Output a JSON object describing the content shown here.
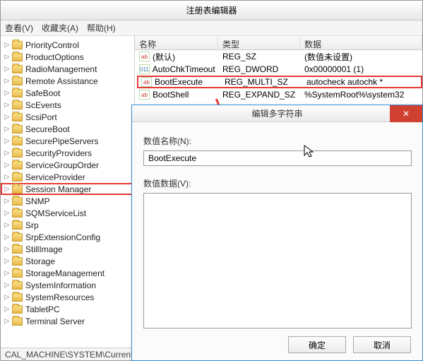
{
  "window": {
    "title": "注册表编辑器"
  },
  "menu": {
    "view": "查看(V)",
    "fav": "收藏夹(A)",
    "help": "帮助(H)"
  },
  "tree": {
    "items": [
      "PriorityControl",
      "ProductOptions",
      "RadioManagement",
      "Remote Assistance",
      "SafeBoot",
      "ScEvents",
      "ScsiPort",
      "SecureBoot",
      "SecurePipeServers",
      "SecurityProviders",
      "ServiceGroupOrder",
      "ServiceProvider",
      "Session Manager",
      "SNMP",
      "SQMServiceList",
      "Srp",
      "SrpExtensionConfig",
      "StillImage",
      "Storage",
      "StorageManagement",
      "SystemInformation",
      "SystemResources",
      "TabletPC",
      "Terminal Server"
    ],
    "highlighted_index": 12
  },
  "list": {
    "headers": {
      "name": "名称",
      "type": "类型",
      "data": "数据"
    },
    "rows": [
      {
        "icon": "sz",
        "name": "(默认)",
        "type": "REG_SZ",
        "data": "(数值未设置)"
      },
      {
        "icon": "bin",
        "name": "AutoChkTimeout",
        "type": "REG_DWORD",
        "data": "0x00000001 (1)"
      },
      {
        "icon": "sz",
        "name": "BootExecute",
        "type": "REG_MULTI_SZ",
        "data": "autocheck autochk *"
      },
      {
        "icon": "sz",
        "name": "BootShell",
        "type": "REG_EXPAND_SZ",
        "data": "%SystemRoot%\\system32"
      }
    ],
    "highlighted_index": 2
  },
  "statusbar": {
    "path": "CAL_MACHINE\\SYSTEM\\Current"
  },
  "dialog": {
    "title": "编辑多字符串",
    "name_label": "数值名称(N):",
    "name_value": "BootExecute",
    "data_label": "数值数据(V):",
    "data_value": "",
    "ok": "确定",
    "cancel": "取消"
  }
}
